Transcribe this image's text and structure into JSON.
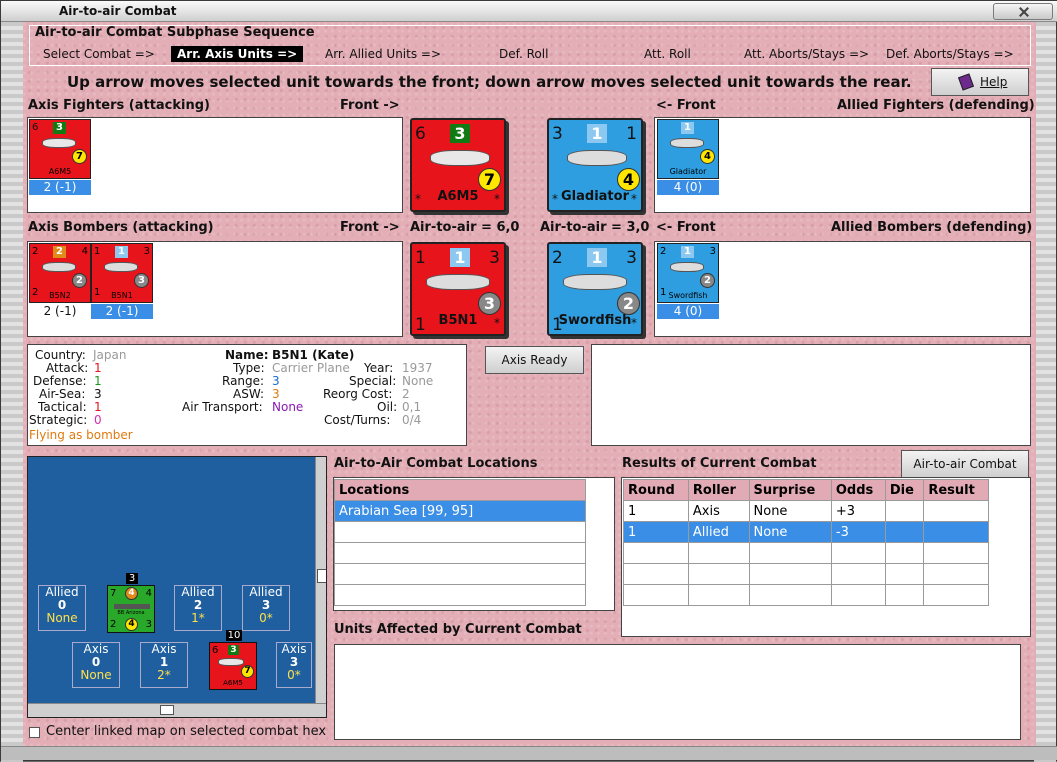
{
  "window": {
    "title": "Air-to-air Combat"
  },
  "sequence": {
    "title": "Air-to-air Combat Subphase Sequence",
    "steps": [
      "Select Combat =>",
      "Arr. Axis Units =>",
      "Arr. Allied Units =>",
      "Def. Roll",
      "Att. Roll",
      "Att. Aborts/Stays =>",
      "Def. Aborts/Stays =>"
    ]
  },
  "instruction": "Up arrow moves selected unit towards the front; down arrow moves selected unit towards the rear.",
  "help_label": "Help",
  "fighters": {
    "axis_label": "Axis Fighters (attacking)",
    "front_axis": "Front ->",
    "front_allied": "<- Front",
    "allied_label": "Allied Fighters (defending)",
    "axis_units": [
      {
        "name": "A6M5",
        "tl": "6",
        "badge": "3",
        "circle": "7",
        "strength": "2 (-1)"
      }
    ],
    "allied_units": [
      {
        "name": "Gladiator",
        "tl": "1",
        "badge": "1",
        "circle": "4",
        "strength": "4 (0)"
      }
    ],
    "big_axis": {
      "name": "A6M5",
      "tl": "6",
      "badge": "3",
      "circle": "7",
      "star": "*"
    },
    "big_allied": {
      "name": "Gladiator",
      "tl": "3",
      "badge": "1",
      "tr": "1",
      "circle": "4",
      "star": "*"
    }
  },
  "bombers": {
    "axis_label": "Axis Bombers (attacking)",
    "front_axis": "Front ->",
    "air_axis": "Air-to-air = 6,0",
    "air_allied": "Air-to-air = 3,0",
    "front_allied": "<- Front",
    "allied_label": "Allied Bombers (defending)",
    "axis_units": [
      {
        "name": "B5N2",
        "tl": "2",
        "badge": "2",
        "tr": "4",
        "circle": "2",
        "bl": "2",
        "strength": "2 (-1)"
      },
      {
        "name": "B5N1",
        "tl": "1",
        "badge": "1",
        "tr": "3",
        "circle": "3",
        "bl": "1",
        "strength": "2 (-1)"
      }
    ],
    "allied_units": [
      {
        "name": "Swordfish",
        "tl": "2",
        "badge": "1",
        "tr": "3",
        "circle": "2",
        "bl": "1",
        "strength": "4 (0)"
      }
    ],
    "big_axis": {
      "name": "B5N1",
      "tl": "1",
      "badge": "1",
      "tr": "3",
      "circle": "3",
      "bl": "1",
      "star": "*"
    },
    "big_allied": {
      "name": "Swordfish",
      "tl": "2",
      "badge": "1",
      "tr": "3",
      "circle": "2",
      "bl": "1",
      "star": "*"
    }
  },
  "unit_info": {
    "country_label": "Country:",
    "country": "Japan",
    "attack_label": "Attack:",
    "attack": "1",
    "defense_label": "Defense:",
    "defense": "1",
    "airsea_label": "Air-Sea:",
    "airsea": "3",
    "tactical_label": "Tactical:",
    "tactical": "1",
    "strategic_label": "Strategic:",
    "strategic": "0",
    "flying": "Flying as bomber",
    "name_label": "Name:",
    "name": "B5N1 (Kate)",
    "type_label": "Type:",
    "type": "Carrier Plane",
    "range_label": "Range:",
    "range": "3",
    "asw_label": "ASW:",
    "asw": "3",
    "airtransport_label": "Air Transport:",
    "airtransport": "None",
    "year_label": "Year:",
    "year": "1937",
    "special_label": "Special:",
    "special": "None",
    "reorg_label": "Reorg Cost:",
    "reorg": "2",
    "oil_label": "Oil:",
    "oil": "0,1",
    "costturns_label": "Cost/Turns:",
    "costturns": "0/4"
  },
  "axis_ready_label": "Axis Ready",
  "map": {
    "allied_hexes": [
      {
        "label": "Allied",
        "count": "0",
        "sub": "None"
      },
      {
        "label": "Allied",
        "count": "2",
        "sub": "1*"
      },
      {
        "label": "Allied",
        "count": "3",
        "sub": "0*"
      }
    ],
    "axis_hexes": [
      {
        "label": "Axis",
        "count": "0",
        "sub": "None"
      },
      {
        "label": "Axis",
        "count": "1",
        "sub": "2*"
      },
      {
        "label": "Axis",
        "count": "3",
        "sub": "0*"
      }
    ],
    "ship_count": "3",
    "ship_name": "BB Arizona",
    "ship_tl": "7",
    "ship_badge": "4",
    "ship_tr": "4",
    "ship_bl": "2",
    "ship_circle": "4",
    "ship_br": "3",
    "plane_count": "10",
    "plane_name": "A6M5",
    "plane_tl": "6",
    "plane_badge": "3",
    "plane_circle": "7"
  },
  "center_map_label": "Center linked map on selected combat hex",
  "locations": {
    "title": "Air-to-Air Combat Locations",
    "header": "Locations",
    "rows": [
      "Arabian Sea [99, 95]"
    ]
  },
  "results": {
    "title": "Results of Current Combat",
    "chart_button": "Air-to-air Combat Chart",
    "headers": [
      "Round",
      "Roller",
      "Surprise",
      "Odds",
      "Die",
      "Result"
    ],
    "rows": [
      [
        "1",
        "Axis",
        "None",
        "+3",
        "",
        ""
      ],
      [
        "1",
        "Allied",
        "None",
        "-3",
        "",
        ""
      ]
    ]
  },
  "units_affected_title": "Units Affected by Current Combat",
  "colors": {
    "axis_red": "#e8141c",
    "allied_blue": "#2e9ee0",
    "selected_blue": "#3a8ee6",
    "badge_green": "#127a12",
    "badge_orange": "#e08a1a",
    "pink_bg": "#e3aeb6"
  }
}
